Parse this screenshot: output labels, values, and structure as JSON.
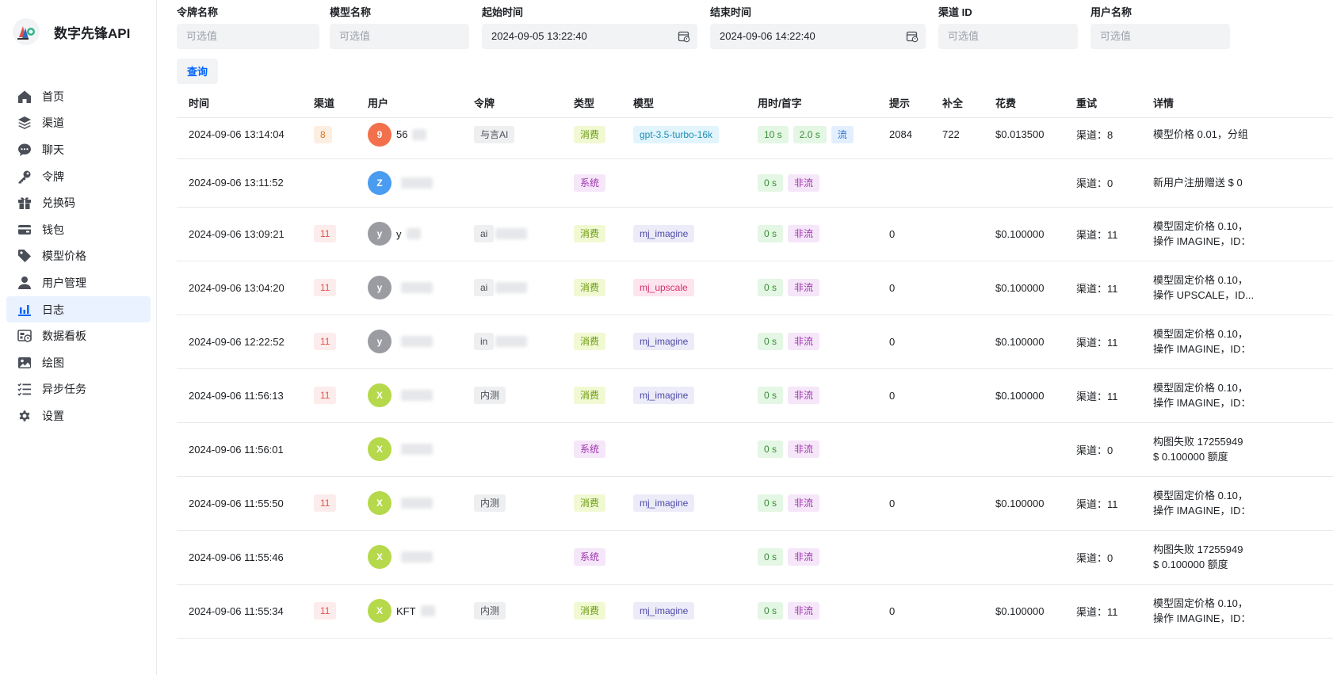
{
  "app": {
    "title": "数字先锋API"
  },
  "colors": {
    "accent": "#0064fa",
    "active_bg": "#eaf1ff"
  },
  "sidebar": {
    "items": [
      {
        "label": "首页",
        "icon": "home-icon",
        "active": false
      },
      {
        "label": "渠道",
        "icon": "layers-icon",
        "active": false
      },
      {
        "label": "聊天",
        "icon": "chat-icon",
        "active": false
      },
      {
        "label": "令牌",
        "icon": "key-icon",
        "active": false
      },
      {
        "label": "兑换码",
        "icon": "gift-icon",
        "active": false
      },
      {
        "label": "钱包",
        "icon": "wallet-icon",
        "active": false
      },
      {
        "label": "模型价格",
        "icon": "tag-icon",
        "active": false
      },
      {
        "label": "用户管理",
        "icon": "user-icon",
        "active": false
      },
      {
        "label": "日志",
        "icon": "bar-chart-icon",
        "active": true
      },
      {
        "label": "数据看板",
        "icon": "dashboard-icon",
        "active": false
      },
      {
        "label": "绘图",
        "icon": "image-icon",
        "active": false
      },
      {
        "label": "异步任务",
        "icon": "task-list-icon",
        "active": false
      },
      {
        "label": "设置",
        "icon": "gear-icon",
        "active": false
      }
    ]
  },
  "filters": {
    "token_name": {
      "label": "令牌名称",
      "placeholder": "可选值"
    },
    "model_name": {
      "label": "模型名称",
      "placeholder": "可选值"
    },
    "start_time": {
      "label": "起始时间",
      "value": "2024-09-05 13:22:40"
    },
    "end_time": {
      "label": "结束时间",
      "value": "2024-09-06 14:22:40"
    },
    "channel_id": {
      "label": "渠道 ID",
      "placeholder": "可选值"
    },
    "user_name": {
      "label": "用户名称",
      "placeholder": "可选值"
    },
    "query_label": "查询"
  },
  "table": {
    "columns": [
      "时间",
      "渠道",
      "用户",
      "令牌",
      "类型",
      "模型",
      "用时/首字",
      "提示",
      "补全",
      "花费",
      "重试",
      "详情"
    ],
    "rows": [
      {
        "time": "2024-09-06 13:14:04",
        "channel": "8",
        "channel_color": "orange",
        "avatar": "9",
        "avatar_color": "#f2704b",
        "user": "56",
        "token": "与言AI",
        "type": "消费",
        "type_kind": "pay",
        "model": "gpt-3.5-turbo-16k",
        "model_color": "blue",
        "use_time": "10 s",
        "first_token": "2.0 s",
        "stream": "流",
        "prompt": "2084",
        "completion": "722",
        "cost": "$0.013500",
        "retry": "渠道：8",
        "detail1": "模型价格 0.01，分组",
        "detail2": ""
      },
      {
        "time": "2024-09-06 13:11:52",
        "channel": "",
        "channel_color": "",
        "avatar": "Z",
        "avatar_color": "#4a9cf0",
        "user": "",
        "token": "",
        "type": "系统",
        "type_kind": "sys",
        "model": "",
        "model_color": "",
        "use_time": "0 s",
        "first_token": "",
        "stream": "非流",
        "prompt": "",
        "completion": "",
        "cost": "",
        "retry": "渠道：0",
        "detail1": "新用户注册赠送 $ 0",
        "detail2": ""
      },
      {
        "time": "2024-09-06 13:09:21",
        "channel": "11",
        "channel_color": "red",
        "avatar": "y",
        "avatar_color": "#9a9ca2",
        "user": "y",
        "token": "ai",
        "type": "消费",
        "type_kind": "pay",
        "model": "mj_imagine",
        "model_color": "purple",
        "use_time": "0 s",
        "first_token": "",
        "stream": "非流",
        "prompt": "0",
        "completion": "",
        "cost": "$0.100000",
        "retry": "渠道：11",
        "detail1": "模型固定价格 0.10，",
        "detail2": "操作 IMAGINE，ID："
      },
      {
        "time": "2024-09-06 13:04:20",
        "channel": "11",
        "channel_color": "red",
        "avatar": "y",
        "avatar_color": "#9a9ca2",
        "user": "",
        "token": "ai",
        "type": "消费",
        "type_kind": "pay",
        "model": "mj_upscale",
        "model_color": "pink",
        "use_time": "0 s",
        "first_token": "",
        "stream": "非流",
        "prompt": "0",
        "completion": "",
        "cost": "$0.100000",
        "retry": "渠道：11",
        "detail1": "模型固定价格 0.10，",
        "detail2": "操作 UPSCALE，ID..."
      },
      {
        "time": "2024-09-06 12:22:52",
        "channel": "11",
        "channel_color": "red",
        "avatar": "y",
        "avatar_color": "#9a9ca2",
        "user": "",
        "token": "in",
        "type": "消费",
        "type_kind": "pay",
        "model": "mj_imagine",
        "model_color": "purple",
        "use_time": "0 s",
        "first_token": "",
        "stream": "非流",
        "prompt": "0",
        "completion": "",
        "cost": "$0.100000",
        "retry": "渠道：11",
        "detail1": "模型固定价格 0.10，",
        "detail2": "操作 IMAGINE，ID："
      },
      {
        "time": "2024-09-06 11:56:13",
        "channel": "11",
        "channel_color": "red",
        "avatar": "X",
        "avatar_color": "#b5d94a",
        "user": "",
        "token": "内测",
        "type": "消费",
        "type_kind": "pay",
        "model": "mj_imagine",
        "model_color": "purple",
        "use_time": "0 s",
        "first_token": "",
        "stream": "非流",
        "prompt": "0",
        "completion": "",
        "cost": "$0.100000",
        "retry": "渠道：11",
        "detail1": "模型固定价格 0.10，",
        "detail2": "操作 IMAGINE，ID："
      },
      {
        "time": "2024-09-06 11:56:01",
        "channel": "",
        "channel_color": "",
        "avatar": "X",
        "avatar_color": "#b5d94a",
        "user": "",
        "token": "",
        "type": "系统",
        "type_kind": "sys",
        "model": "",
        "model_color": "",
        "use_time": "0 s",
        "first_token": "",
        "stream": "非流",
        "prompt": "",
        "completion": "",
        "cost": "",
        "retry": "渠道：0",
        "detail1": "构图失败 17255949",
        "detail2": "$ 0.100000 额度"
      },
      {
        "time": "2024-09-06 11:55:50",
        "channel": "11",
        "channel_color": "red",
        "avatar": "X",
        "avatar_color": "#b5d94a",
        "user": "",
        "token": "内测",
        "type": "消费",
        "type_kind": "pay",
        "model": "mj_imagine",
        "model_color": "purple",
        "use_time": "0 s",
        "first_token": "",
        "stream": "非流",
        "prompt": "0",
        "completion": "",
        "cost": "$0.100000",
        "retry": "渠道：11",
        "detail1": "模型固定价格 0.10，",
        "detail2": "操作 IMAGINE，ID："
      },
      {
        "time": "2024-09-06 11:55:46",
        "channel": "",
        "channel_color": "",
        "avatar": "X",
        "avatar_color": "#b5d94a",
        "user": "",
        "token": "",
        "type": "系统",
        "type_kind": "sys",
        "model": "",
        "model_color": "",
        "use_time": "0 s",
        "first_token": "",
        "stream": "非流",
        "prompt": "",
        "completion": "",
        "cost": "",
        "retry": "渠道：0",
        "detail1": "构图失败 17255949",
        "detail2": "$ 0.100000 额度"
      },
      {
        "time": "2024-09-06 11:55:34",
        "channel": "11",
        "channel_color": "red",
        "avatar": "X",
        "avatar_color": "#b5d94a",
        "user": "KFT",
        "token": "内测",
        "type": "消费",
        "type_kind": "pay",
        "model": "mj_imagine",
        "model_color": "purple",
        "use_time": "0 s",
        "first_token": "",
        "stream": "非流",
        "prompt": "0",
        "completion": "",
        "cost": "$0.100000",
        "retry": "渠道：11",
        "detail1": "模型固定价格 0.10，",
        "detail2": "操作 IMAGINE，ID："
      }
    ]
  }
}
